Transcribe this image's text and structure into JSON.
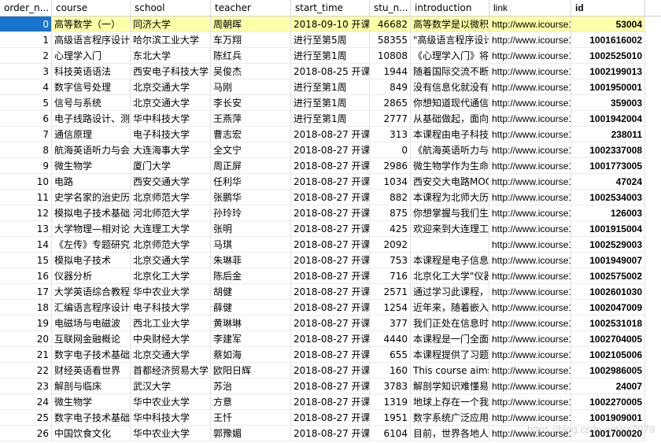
{
  "columns": [
    "order_n...",
    "course",
    "school",
    "teacher",
    "start_time",
    "stu_n...",
    "introduction",
    "link",
    "id"
  ],
  "selected_row": 0,
  "rows": [
    [
      "0",
      "高等数学（一）",
      "同济大学",
      "周朝晖",
      "2018-09-10 开课",
      "46682",
      "高等数学是以微积分",
      "http://www.icourse163.org",
      "53004"
    ],
    [
      "1",
      "高级语言程序设计",
      "哈尔滨工业大学",
      "车万翔",
      "进行至第5周",
      "58355",
      "\"高级语言程序设计",
      "http://www.icourse163.org",
      "1001616002"
    ],
    [
      "2",
      "心理学入门",
      "东北大学",
      "陈红兵",
      "进行至第1周",
      "10808",
      "《心理学入门》将",
      "http://www.icourse163.org",
      "1002525010"
    ],
    [
      "3",
      "科技英语语法",
      "西安电子科技大学",
      "吴俊杰",
      "2018-08-25 开课",
      "1944",
      "随着国际交流不断",
      "http://www.icourse163.org",
      "1002199013"
    ],
    [
      "4",
      "数字信号处理",
      "北京交通大学",
      "马刚",
      "进行至第1周",
      "849",
      "没有信息化就没有",
      "http://www.icourse163.org",
      "1001950001"
    ],
    [
      "5",
      "信号与系统",
      "北京交通大学",
      "李长安",
      "进行至第1周",
      "2865",
      "你想知道现代通信",
      "http://www.icourse163.org",
      "359003"
    ],
    [
      "6",
      "电子线路设计、测",
      "华中科技大学",
      "王燕萍",
      "进行至第1周",
      "2777",
      "从基础做起，面向",
      "http://www.icourse163.org",
      "1001942004"
    ],
    [
      "7",
      "通信原理",
      "电子科技大学",
      "曹志宏",
      "2018-08-27 开课",
      "313",
      "本课程由电子科技",
      "http://www.icourse163.org",
      "238011"
    ],
    [
      "8",
      "航海英语听力与会",
      "大连海事大学",
      "全文宁",
      "2018-08-27 开课",
      "0",
      "《航海英语听力与",
      "http://www.icourse163.org",
      "1002337008"
    ],
    [
      "9",
      "微生物学",
      "厦门大学",
      "周正屏",
      "2018-08-27 开课",
      "2986",
      "微生物学作为生命",
      "http://www.icourse163.org",
      "1001773005"
    ],
    [
      "10",
      "电路",
      "西安交通大学",
      "任利华",
      "2018-08-27 开课",
      "1034",
      "西安交大电路MOOC",
      "http://www.icourse163.org",
      "47024"
    ],
    [
      "11",
      "史学名家的治史历",
      "北京师范大学",
      "张鹏华",
      "2018-08-27 开课",
      "882",
      "本课程为北师大历",
      "http://www.icourse163.org",
      "1002534003"
    ],
    [
      "12",
      "模拟电子技术基础",
      "河北师范大学",
      "孙玲玲",
      "2018-08-27 开课",
      "875",
      "你想掌握与我们生",
      "http://www.icourse163.org",
      "126003"
    ],
    [
      "13",
      "大学物理—相对论、",
      "大连理工大学",
      "张明",
      "2018-08-27 开课",
      "425",
      "欢迎来到大连理工",
      "http://www.icourse163.org",
      "1001915004"
    ],
    [
      "14",
      "《左传》专题研究",
      "北京师范大学",
      "马琪",
      "2018-08-27 开课",
      "2092",
      "",
      "http://www.icourse163.org",
      "1002529003"
    ],
    [
      "15",
      "模拟电子技术",
      "北京交通大学",
      "朱琳菲",
      "2018-08-27 开课",
      "753",
      "本课程是电子信息",
      "http://www.icourse163.org",
      "1001949007"
    ],
    [
      "16",
      "仪器分析",
      "北京化工大学",
      "陈后金",
      "2018-08-27 开课",
      "716",
      "北京化工大学\"仪器",
      "http://www.icourse163.org",
      "1002575002"
    ],
    [
      "17",
      "大学英语综合教程",
      "华中农业大学",
      "胡健",
      "2018-08-27 开课",
      "2571",
      "通过学习此课程，",
      "http://www.icourse163.org",
      "1002601030"
    ],
    [
      "18",
      "汇编语言程序设计",
      "电子科技大学",
      "薛健",
      "2018-08-27 开课",
      "1254",
      "近年来，随着嵌入",
      "http://www.icourse163.org",
      "1002047009"
    ],
    [
      "19",
      "电磁场与电磁波",
      "西北工业大学",
      "黄琳琳",
      "2018-08-27 开课",
      "377",
      "我们正处在信息时",
      "http://www.icourse163.org",
      "1002531018"
    ],
    [
      "20",
      "互联网金融概论",
      "中央财经大学",
      "李建军",
      "2018-08-27 开课",
      "4440",
      "本课程是一门全面",
      "http://www.icourse163.org",
      "1002704005"
    ],
    [
      "21",
      "数字电子技术基础",
      "北京交通大学",
      "蔡如海",
      "2018-08-27 开课",
      "655",
      "本课程提供了习题",
      "http://www.icourse163.org",
      "1002105006"
    ],
    [
      "22",
      "财经英语看世界",
      "首都经济贸易大学",
      "欧阳日辉",
      "2018-08-27 开课",
      "160",
      "This course aims",
      "http://www.icourse163.org",
      "1002986005"
    ],
    [
      "23",
      "解剖与临床",
      "武汉大学",
      "苏治",
      "2018-08-27 开课",
      "3783",
      "解剖学知识难懂易",
      "http://www.icourse163.org",
      "24007"
    ],
    [
      "24",
      "微生物学",
      "华中农业大学",
      "方意",
      "2018-08-27 开课",
      "1319",
      "地球上存在一个我",
      "http://www.icourse163.org",
      "1002270005"
    ],
    [
      "25",
      "数字电子技术基础",
      "华中科技大学",
      "王忏",
      "2018-08-27 开课",
      "1951",
      "数字系统广泛应用",
      "http://www.icourse163.org",
      "1001909001"
    ],
    [
      "26",
      "中国饮食文化",
      "华中农业大学",
      "郭豫媚",
      "2018-08-27 开课",
      "6104",
      "目前，世界各地人",
      "http://www.icourse163.org",
      "1001700020"
    ]
  ],
  "watermark": "https://blog.csdn.net/ss2079",
  "colors": {
    "selection_index_bg": "#1874cd",
    "selection_row_bg": "#ffffa8"
  }
}
